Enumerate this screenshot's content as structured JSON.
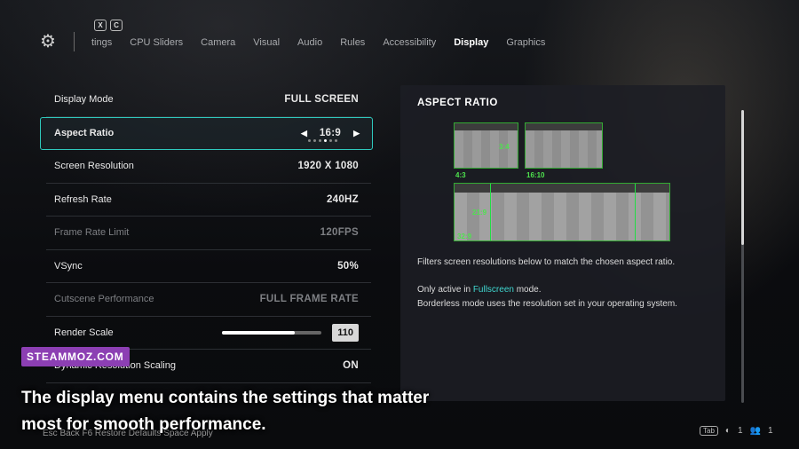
{
  "top": {
    "keys": [
      "X",
      "C"
    ],
    "tabs": [
      {
        "label": "tings"
      },
      {
        "label": "CPU Sliders"
      },
      {
        "label": "Camera"
      },
      {
        "label": "Visual"
      },
      {
        "label": "Audio"
      },
      {
        "label": "Rules"
      },
      {
        "label": "Accessibility"
      },
      {
        "label": "Display",
        "active": true
      },
      {
        "label": "Graphics"
      }
    ]
  },
  "settings": [
    {
      "label": "Display Mode",
      "value": "FULL SCREEN"
    },
    {
      "label": "Aspect Ratio",
      "value": "16:9",
      "selected": true,
      "dots": 6,
      "active_dot": 4
    },
    {
      "label": "Screen Resolution",
      "value": "1920 X 1080"
    },
    {
      "label": "Refresh Rate",
      "value": "240HZ"
    },
    {
      "label": "Frame Rate Limit",
      "value": "120FPS",
      "disabled": true
    },
    {
      "label": "VSync",
      "value": "50%"
    },
    {
      "label": "Cutscene Performance",
      "value": "FULL FRAME RATE",
      "disabled": true
    },
    {
      "label": "Render Scale",
      "value": "110",
      "slider_fraction": 0.73
    },
    {
      "label": "Dynamic Resolution Scaling",
      "value": "ON"
    }
  ],
  "panel": {
    "title": "ASPECT RATIO",
    "ratio_labels": [
      "3:4",
      "4:3",
      "16:10",
      "21:9",
      "32:9"
    ],
    "desc1": "Filters screen resolutions below to match the chosen aspect ratio.",
    "desc2_pre": "Only active in ",
    "desc2_hl": "Fullscreen",
    "desc2_post": " mode.",
    "desc3": "Borderless mode uses the resolution set in your operating system.",
    "accent_color": "#3fd7d0"
  },
  "footer": {
    "left": "Esc  Back    F6  Restore Defaults    Space  Apply",
    "tab_key": "Tab",
    "count1": "1",
    "count2": "1"
  },
  "watermark": "STEAMMOZ.COM",
  "caption": "The display menu contains the settings that matter most for smooth performance."
}
